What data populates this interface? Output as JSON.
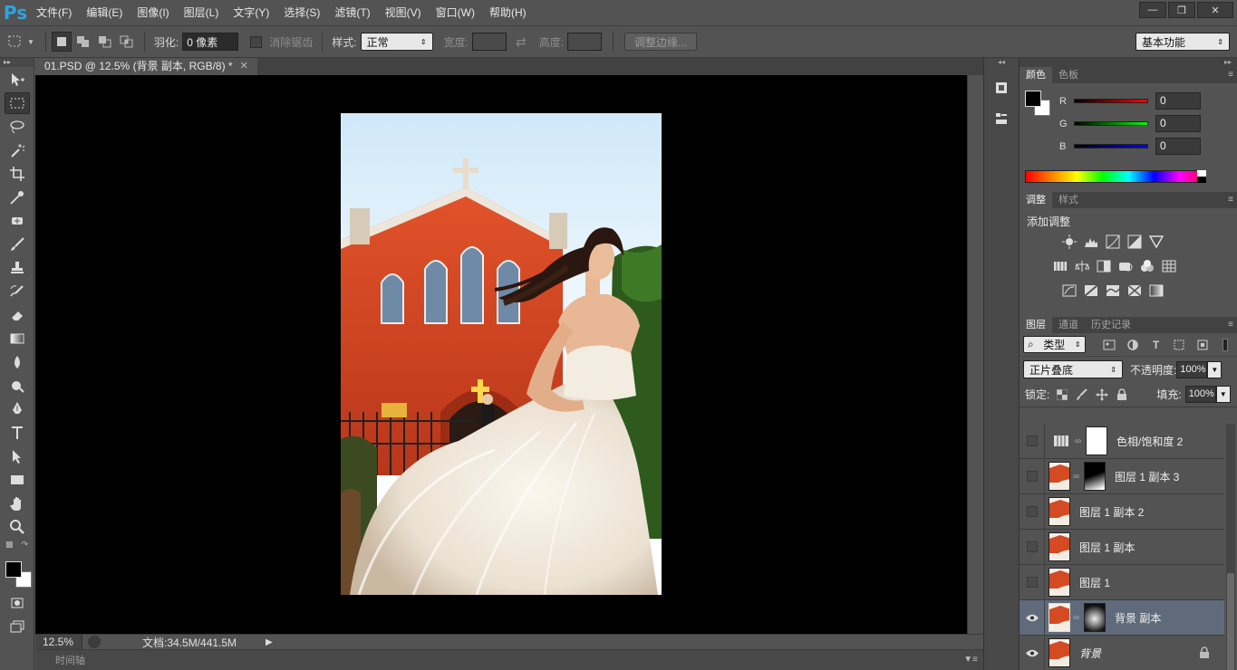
{
  "app": {
    "logo": "Ps",
    "menu": [
      "文件(F)",
      "编辑(E)",
      "图像(I)",
      "图层(L)",
      "文字(Y)",
      "选择(S)",
      "滤镜(T)",
      "视图(V)",
      "窗口(W)",
      "帮助(H)"
    ],
    "window_controls": [
      "minimize",
      "restore",
      "close"
    ]
  },
  "options_bar": {
    "feather_label": "羽化:",
    "feather_value": "0 像素",
    "antialias_label": "消除锯齿",
    "style_label": "样式:",
    "style_value": "正常",
    "width_label": "宽度:",
    "height_label": "高度:",
    "refine_edge_label": "调整边缘...",
    "workspace_value": "基本功能"
  },
  "document": {
    "tab_title": "01.PSD @ 12.5% (背景 副本, RGB/8) *",
    "zoom": "12.5%",
    "doc_size": "文档:34.5M/441.5M",
    "timeline_label": "时间轴"
  },
  "color_panel": {
    "tabs": [
      "颜色",
      "色板"
    ],
    "channels": [
      {
        "label": "R",
        "value": "0",
        "color": "#ff0000"
      },
      {
        "label": "G",
        "value": "0",
        "color": "#00ff00"
      },
      {
        "label": "B",
        "value": "0",
        "color": "#0000ff"
      }
    ]
  },
  "adjustments_panel": {
    "tabs": [
      "调整",
      "样式"
    ],
    "title": "添加调整"
  },
  "layers_panel": {
    "tabs": [
      "图层",
      "通道",
      "历史记录"
    ],
    "filter_value": "类型",
    "blend_mode": "正片叠底",
    "opacity_label": "不透明度:",
    "opacity_value": "100%",
    "lock_label": "锁定:",
    "fill_label": "填充:",
    "fill_value": "100%",
    "layers": [
      {
        "name": "色相/饱和度 2",
        "visible": false,
        "type": "adjustment",
        "mask": "white"
      },
      {
        "name": "图层 1 副本 3",
        "visible": false,
        "type": "image",
        "mask": "gradient"
      },
      {
        "name": "图层 1 副本 2",
        "visible": false,
        "type": "image",
        "mask": null
      },
      {
        "name": "图层 1 副本",
        "visible": false,
        "type": "image",
        "mask": null
      },
      {
        "name": "图层 1",
        "visible": false,
        "type": "image",
        "mask": null
      },
      {
        "name": "背景 副本",
        "visible": true,
        "type": "image",
        "mask": "spot",
        "selected": true
      },
      {
        "name": "背景",
        "visible": true,
        "type": "image",
        "mask": null,
        "locked": true,
        "italic": true
      }
    ]
  }
}
